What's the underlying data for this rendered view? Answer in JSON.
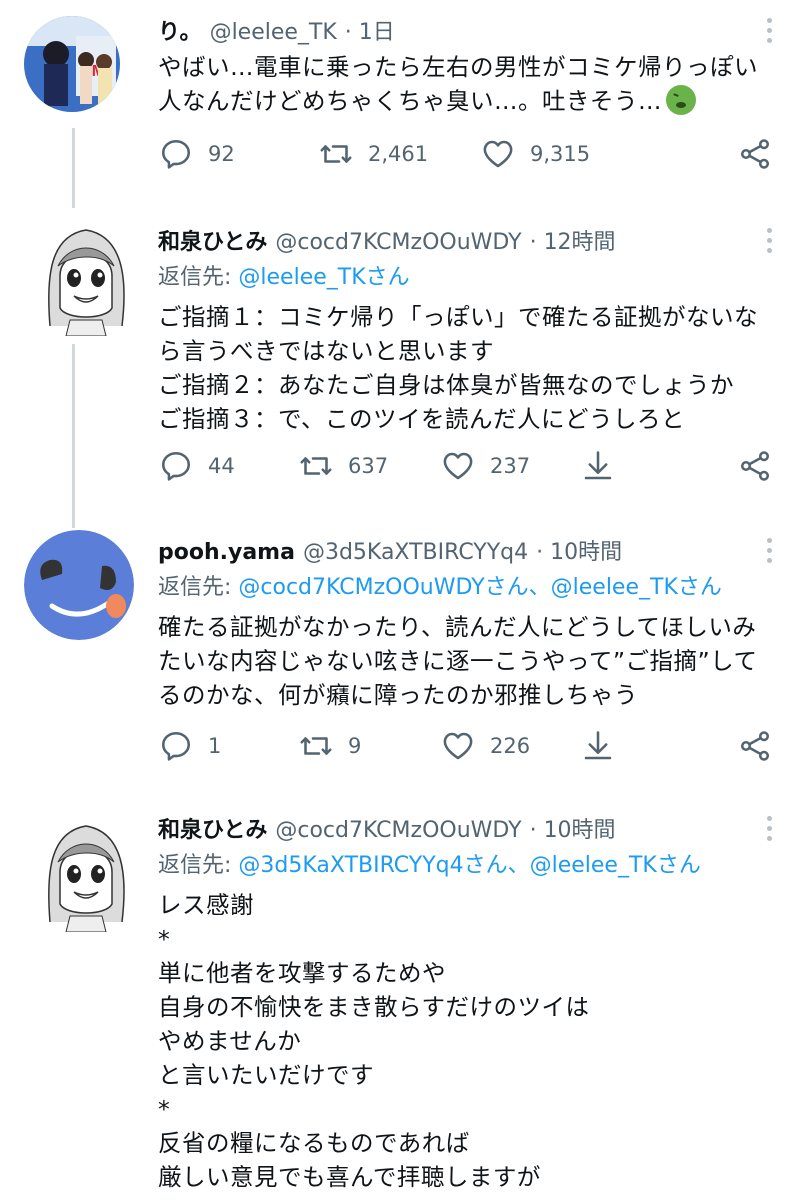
{
  "tweets": [
    {
      "name": "り。",
      "handle": "@leelee_TK",
      "time": "· 1日",
      "body": "やばい…電車に乗ったら左右の男性がコミケ帰りっぽい人なんだけどめちゃくちゃ臭い…。吐きそう…",
      "emoji": "nauseated-face-emoji",
      "reply_count": "92",
      "retweet_count": "2,461",
      "like_count": "9,315"
    },
    {
      "name": "和泉ひとみ",
      "handle": "@cocd7KCMzOOuWDY",
      "time": "· 12時間",
      "reply_prefix": "返信先: ",
      "reply_targets": "@leelee_TKさん",
      "body": "ご指摘１：コミケ帰り「っぽい」で確たる証拠がないなら言うべきではないと思います\nご指摘２：あなたご自身は体臭が皆無なのでしょうか\nご指摘３：で、このツイを読んだ人にどうしろと",
      "reply_count": "44",
      "retweet_count": "637",
      "like_count": "237"
    },
    {
      "name": "pooh.yama",
      "handle": "@3d5KaXTBIRCYYq4",
      "time": "· 10時間",
      "reply_prefix": "返信先: ",
      "reply_targets": "@cocd7KCMzOOuWDYさん、@leelee_TKさん",
      "body": "確たる証拠がなかったり、読んだ人にどうしてほしいみたいな内容じゃない呟きに逐一こうやって”ご指摘”してるのかな、何が癪に障ったのか邪推しちゃう",
      "reply_count": "1",
      "retweet_count": "9",
      "like_count": "226"
    },
    {
      "name": "和泉ひとみ",
      "handle": "@cocd7KCMzOOuWDY",
      "time": "· 10時間",
      "reply_prefix": "返信先: ",
      "reply_targets": "@3d5KaXTBIRCYYq4さん、@leelee_TKさん",
      "body": "レス感謝\n*\n単に他者を攻撃するためや\n自身の不愉快をまき散らすだけのツイは\nやめませんか\nと言いたいだけです\n*\n反省の糧になるものであれば\n厳しい意見でも喜んで拝聴しますが"
    }
  ],
  "colors": {
    "text": "#0f1419",
    "secondary": "#536471",
    "link": "#1d9bf0",
    "thread_line": "#cfd9de",
    "avatar3_bg": "#5b7fd9"
  }
}
